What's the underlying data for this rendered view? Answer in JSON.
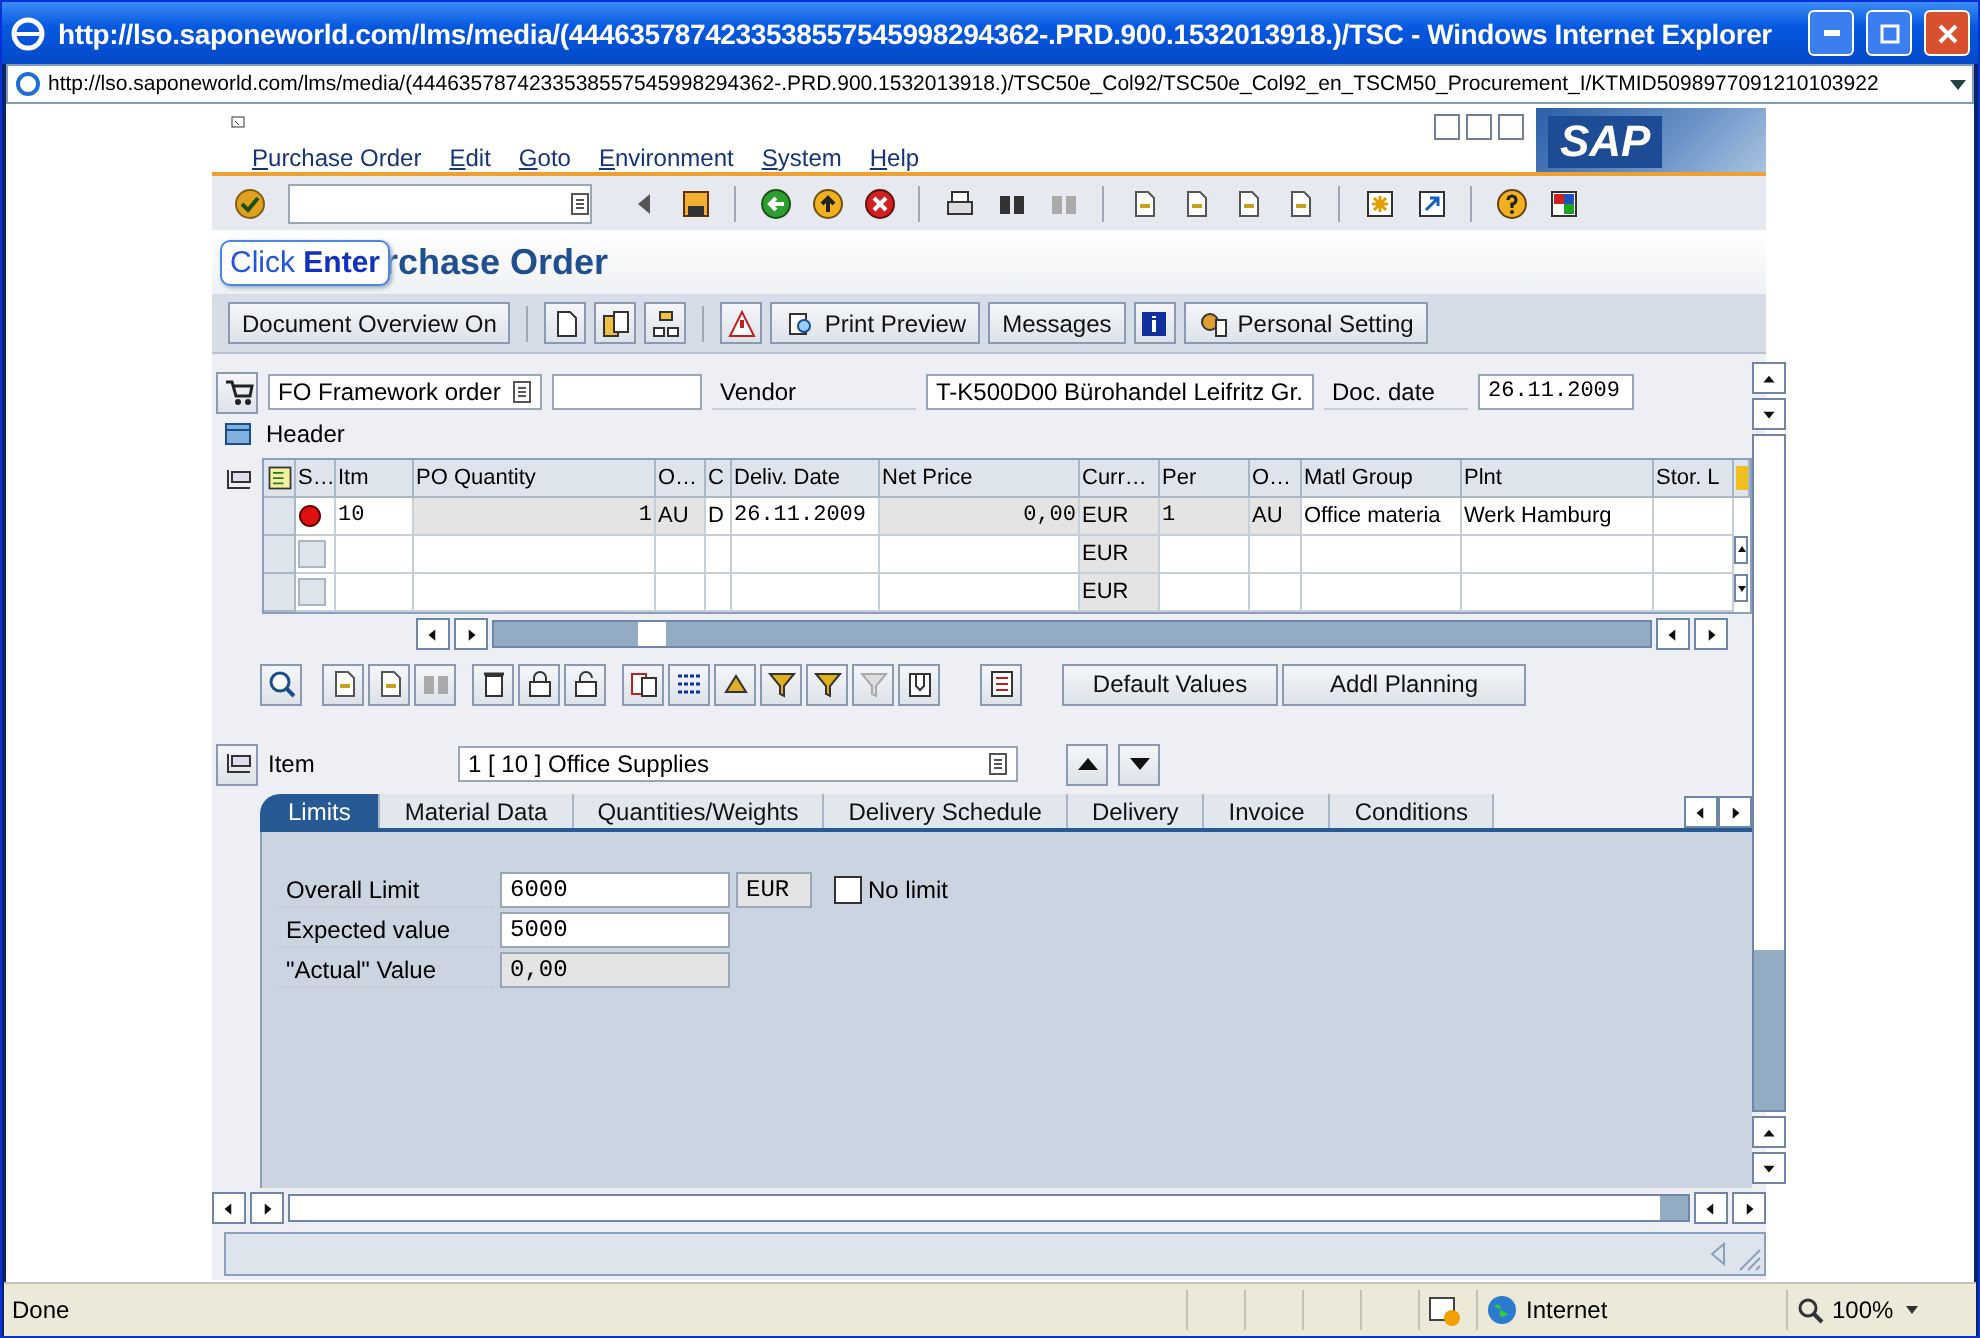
{
  "browser": {
    "title": "http://lso.saponeworld.com/lms/media/(4446357874233538557545998294362-.PRD.900.1532013918.)/TSC - Windows Internet Explorer",
    "address": "http://lso.saponeworld.com/lms/media/(4446357874233538557545998294362-.PRD.900.1532013918.)/TSC50e_Col92/TSC50e_Col92_en_TSCM50_Procurement_I/KTMID5098977091210103922",
    "status": "Done",
    "zone": "Internet",
    "zoom": "100%"
  },
  "menu": [
    "Purchase Order",
    "Edit",
    "Goto",
    "Environment",
    "System",
    "Help"
  ],
  "logo": "SAP",
  "title": "rchase Order",
  "callout": "Click **Enter**",
  "app_toolbar": [
    "Document Overview On",
    "Print Preview",
    "Messages",
    "Personal Setting"
  ],
  "header": {
    "order_type": "FO Framework order",
    "vendor_label": "Vendor",
    "vendor": "T-K500D00 Bürohandel Leifritz Gr.",
    "doc_date_label": "Doc. date",
    "doc_date": "26.11.2009",
    "section": "Header"
  },
  "table": {
    "columns": [
      {
        "label": "S…",
        "kind": "status",
        "readonly": false,
        "lockable": false
      },
      {
        "label": "Itm",
        "kind": "text",
        "readonly": false,
        "lockable": false
      },
      {
        "label": "PO Quantity",
        "kind": "amount",
        "readonly": false,
        "lockable": true
      },
      {
        "label": "O…",
        "kind": "text",
        "readonly": false,
        "lockable": true
      },
      {
        "label": "C",
        "kind": "text",
        "readonly": false,
        "lockable": false
      },
      {
        "label": "Deliv. Date",
        "kind": "text",
        "readonly": false,
        "lockable": false
      },
      {
        "label": "Net Price",
        "kind": "amount",
        "readonly": false,
        "lockable": true
      },
      {
        "label": "Curr…",
        "kind": "text",
        "readonly": true,
        "lockable": false
      },
      {
        "label": "Per",
        "kind": "text",
        "readonly": false,
        "lockable": true
      },
      {
        "label": "O…",
        "kind": "text",
        "readonly": false,
        "lockable": true
      },
      {
        "label": "Matl Group",
        "kind": "text",
        "readonly": false,
        "lockable": false
      },
      {
        "label": "Plnt",
        "kind": "text",
        "readonly": false,
        "lockable": false
      },
      {
        "label": "Stor. L",
        "kind": "text",
        "readonly": false,
        "lockable": false
      }
    ],
    "rows": [
      {
        "error": true,
        "locked": true,
        "cells": [
          "",
          "10",
          "1",
          "AU",
          "D",
          "26.11.2009",
          "0,00",
          "EUR",
          "1",
          "AU",
          "Office materia",
          "Werk Hamburg",
          ""
        ]
      },
      {
        "error": false,
        "locked": false,
        "cells": [
          "",
          "",
          "",
          "",
          "",
          "",
          "",
          "EUR",
          "",
          "",
          "",
          "",
          ""
        ]
      },
      {
        "error": false,
        "locked": false,
        "cells": [
          "",
          "",
          "",
          "",
          "",
          "",
          "",
          "EUR",
          "",
          "",
          "",
          "",
          ""
        ]
      }
    ]
  },
  "table_buttons": [
    "Default Values",
    "Addl Planning"
  ],
  "item": {
    "label": "Item",
    "value": "1 [ 10 ] Office Supplies"
  },
  "tabs": [
    {
      "label": "Limits",
      "selected": true
    },
    {
      "label": "Material Data",
      "selected": false
    },
    {
      "label": "Quantities/Weights",
      "selected": false
    },
    {
      "label": "Delivery Schedule",
      "selected": false
    },
    {
      "label": "Delivery",
      "selected": false
    },
    {
      "label": "Invoice",
      "selected": false
    },
    {
      "label": "Conditions",
      "selected": false
    }
  ],
  "limits": {
    "fields": [
      {
        "label": "Overall Limit",
        "value": "6000",
        "editable": true,
        "unit": "EUR"
      },
      {
        "label": "Expected value",
        "value": "5000",
        "editable": true
      },
      {
        "label": "\"Actual\" Value",
        "value": "0,00",
        "editable": false
      }
    ],
    "no_limit": {
      "label": "No limit",
      "checked": false
    }
  }
}
